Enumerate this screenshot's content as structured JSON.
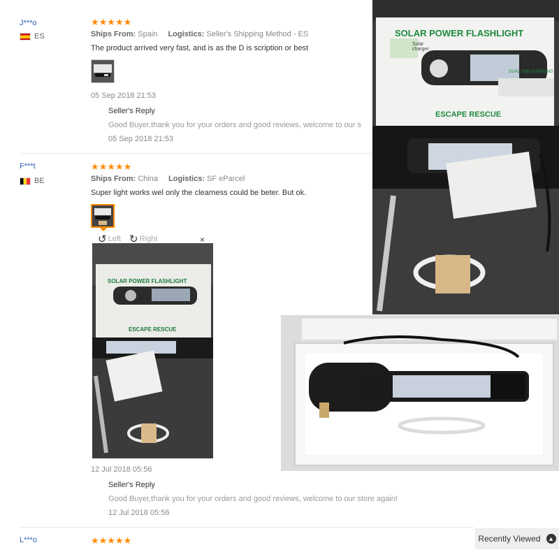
{
  "reviews": [
    {
      "user": "J***o",
      "country_code": "ES",
      "stars": "★★★★★",
      "ships_from_label": "Ships From:",
      "ships_from": "Spain",
      "logistics_label": "Logistics:",
      "logistics": "Seller's Shipping Method - ES",
      "text": "The product arrived very fast, and is as the D is scription or best",
      "date": "05 Sep 2018 21:53",
      "reply_title": "Seller's Reply",
      "reply_text": "Good Buyer,thank you for your orders and good reviews, welcome to our s",
      "reply_date": "05 Sep 2018 21:53"
    },
    {
      "user": "F***t",
      "country_code": "BE",
      "stars": "★★★★★",
      "ships_from_label": "Ships From:",
      "ships_from": "China",
      "logistics_label": "Logistics:",
      "logistics": "SF eParcel",
      "text": "Super light works wel only the clearness could be beter. But ok.",
      "date": "12 Jul 2018 05:56",
      "reply_title": "Seller's Reply",
      "reply_text": "Good Buyer,thank you for your orders and good reviews, welcome to our store again!",
      "reply_date": "12 Jul 2018 05:56"
    },
    {
      "user": "L***o",
      "stars": "★★★★★"
    }
  ],
  "viewer": {
    "rotate_left": "Left",
    "rotate_right": "Right",
    "close": "×"
  },
  "product": {
    "box_title": "SOLAR POWER FLASHLIGHT",
    "box_subtitle": "ESCAPE RESCUE",
    "solar_label": "Solar charger",
    "usb_label": "DUAL USB CHARGING"
  },
  "recently_viewed": "Recently Viewed",
  "colors": {
    "star": "#ff8a00",
    "username": "#2d5fb3",
    "accent": "#ff8a00"
  }
}
